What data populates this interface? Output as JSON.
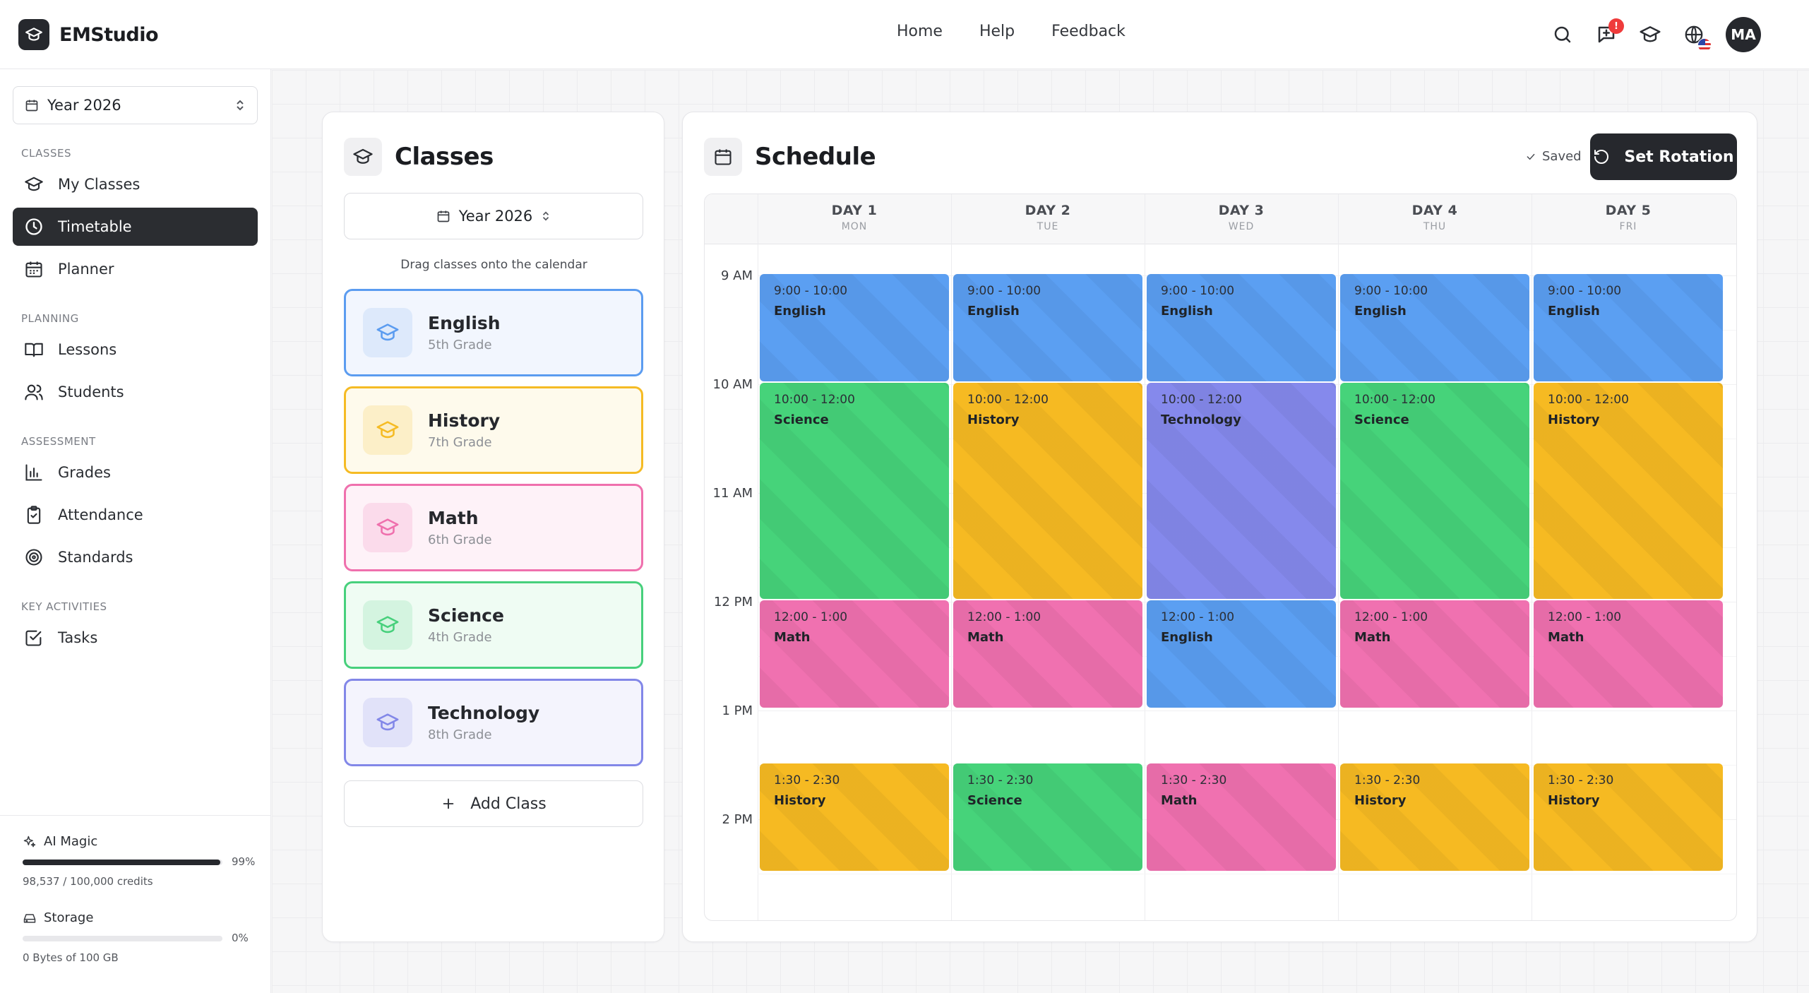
{
  "app": {
    "name": "EMStudio"
  },
  "topnav": {
    "home": "Home",
    "help": "Help",
    "feedback": "Feedback"
  },
  "header": {
    "notification_badge": "!",
    "avatar_initials": "MA"
  },
  "sidebar": {
    "year_select": "Year 2026",
    "sections": {
      "classes": "CLASSES",
      "planning": "PLANNING",
      "assessment": "ASSESSMENT",
      "key_activities": "KEY ACTIVITIES"
    },
    "items": {
      "my_classes": "My Classes",
      "timetable": "Timetable",
      "planner": "Planner",
      "lessons": "Lessons",
      "students": "Students",
      "grades": "Grades",
      "attendance": "Attendance",
      "standards": "Standards",
      "tasks": "Tasks"
    },
    "ai_magic": {
      "label": "AI Magic",
      "percent": "99%",
      "fill": 0.99,
      "credits": "98,537 / 100,000 credits"
    },
    "storage": {
      "label": "Storage",
      "percent": "0%",
      "fill": 0.0,
      "usage": "0 Bytes of 100 GB"
    }
  },
  "classes_panel": {
    "title": "Classes",
    "year": "Year 2026",
    "hint": "Drag classes onto the calendar",
    "add_label": "Add Class",
    "classes": [
      {
        "name": "English",
        "grade": "5th Grade",
        "border": "#5b9cf0",
        "bg": "#f2f6fe",
        "icon_bg": "#dde9fb",
        "icon_color": "#5b9cf0"
      },
      {
        "name": "History",
        "grade": "7th Grade",
        "border": "#f5bb24",
        "bg": "#fefaec",
        "icon_bg": "#fcefc8",
        "icon_color": "#f5bb24"
      },
      {
        "name": "Math",
        "grade": "6th Grade",
        "border": "#ef70ad",
        "bg": "#fef2f8",
        "icon_bg": "#fbdbeb",
        "icon_color": "#ef70ad"
      },
      {
        "name": "Science",
        "grade": "4th Grade",
        "border": "#47d07c",
        "bg": "#effcf3",
        "icon_bg": "#d4f4e0",
        "icon_color": "#47d07c"
      },
      {
        "name": "Technology",
        "grade": "8th Grade",
        "border": "#8287e8",
        "bg": "#f4f4fd",
        "icon_bg": "#e1e2f9",
        "icon_color": "#8287e8"
      }
    ]
  },
  "schedule": {
    "title": "Schedule",
    "saved": "Saved",
    "rotation_button": "Set Rotation",
    "colors": {
      "English": "#5b9ff2",
      "History": "#f6ba22",
      "Math": "#f071b0",
      "Science": "#46d37a",
      "Technology": "#8589ec"
    },
    "days": [
      {
        "label": "DAY 1",
        "weekday": "MON"
      },
      {
        "label": "DAY 2",
        "weekday": "TUE"
      },
      {
        "label": "DAY 3",
        "weekday": "WED"
      },
      {
        "label": "DAY 4",
        "weekday": "THU"
      },
      {
        "label": "DAY 5",
        "weekday": "FRI"
      }
    ],
    "times": [
      "9 AM",
      "10 AM",
      "11 AM",
      "12 PM",
      "1 PM",
      "2 PM"
    ],
    "events": [
      {
        "day": 0,
        "start": 9,
        "end": 10,
        "time": "9:00 - 10:00",
        "name": "English"
      },
      {
        "day": 1,
        "start": 9,
        "end": 10,
        "time": "9:00 - 10:00",
        "name": "English"
      },
      {
        "day": 2,
        "start": 9,
        "end": 10,
        "time": "9:00 - 10:00",
        "name": "English"
      },
      {
        "day": 3,
        "start": 9,
        "end": 10,
        "time": "9:00 - 10:00",
        "name": "English"
      },
      {
        "day": 4,
        "start": 9,
        "end": 10,
        "time": "9:00 - 10:00",
        "name": "English"
      },
      {
        "day": 0,
        "start": 10,
        "end": 12,
        "time": "10:00 - 12:00",
        "name": "Science"
      },
      {
        "day": 1,
        "start": 10,
        "end": 12,
        "time": "10:00 - 12:00",
        "name": "History"
      },
      {
        "day": 2,
        "start": 10,
        "end": 12,
        "time": "10:00 - 12:00",
        "name": "Technology"
      },
      {
        "day": 3,
        "start": 10,
        "end": 12,
        "time": "10:00 - 12:00",
        "name": "Science"
      },
      {
        "day": 4,
        "start": 10,
        "end": 12,
        "time": "10:00 - 12:00",
        "name": "History"
      },
      {
        "day": 0,
        "start": 12,
        "end": 13,
        "time": "12:00 - 1:00",
        "name": "Math"
      },
      {
        "day": 1,
        "start": 12,
        "end": 13,
        "time": "12:00 - 1:00",
        "name": "Math"
      },
      {
        "day": 2,
        "start": 12,
        "end": 13,
        "time": "12:00 - 1:00",
        "name": "English"
      },
      {
        "day": 3,
        "start": 12,
        "end": 13,
        "time": "12:00 - 1:00",
        "name": "Math"
      },
      {
        "day": 4,
        "start": 12,
        "end": 13,
        "time": "12:00 - 1:00",
        "name": "Math"
      },
      {
        "day": 0,
        "start": 13.5,
        "end": 14.5,
        "time": "1:30 - 2:30",
        "name": "History"
      },
      {
        "day": 1,
        "start": 13.5,
        "end": 14.5,
        "time": "1:30 - 2:30",
        "name": "Science"
      },
      {
        "day": 2,
        "start": 13.5,
        "end": 14.5,
        "time": "1:30 - 2:30",
        "name": "Math"
      },
      {
        "day": 3,
        "start": 13.5,
        "end": 14.5,
        "time": "1:30 - 2:30",
        "name": "History"
      },
      {
        "day": 4,
        "start": 13.5,
        "end": 14.5,
        "time": "1:30 - 2:30",
        "name": "History"
      }
    ]
  }
}
